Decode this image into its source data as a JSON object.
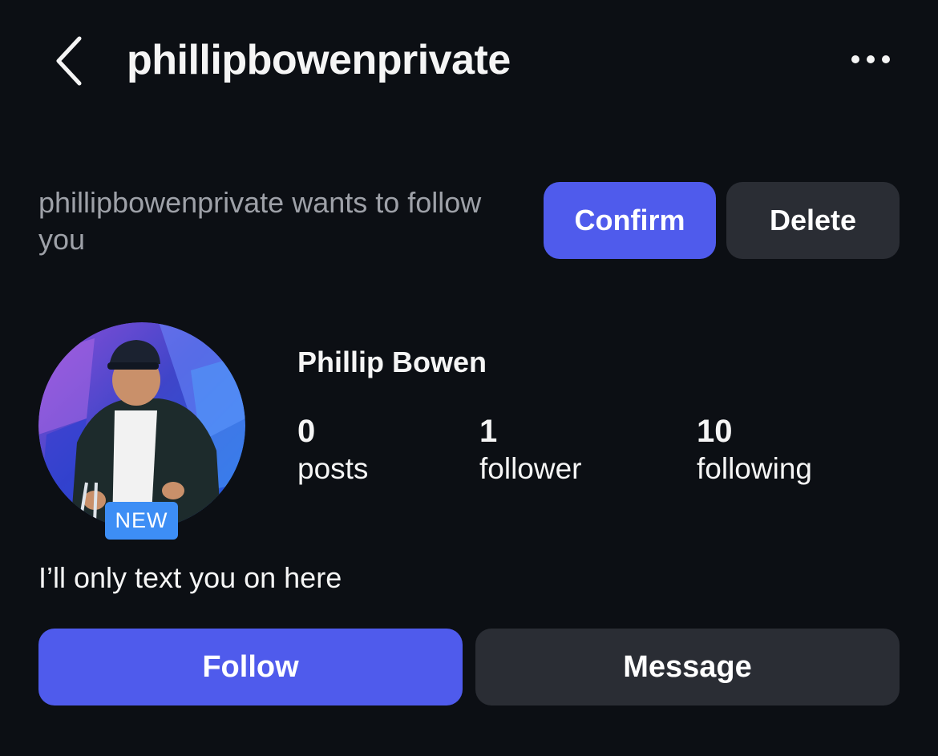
{
  "header": {
    "title": "phillipbowenprivate",
    "back_icon": "chevron-left-icon",
    "more_icon": "more-horizontal-icon"
  },
  "follow_request": {
    "text": "phillipbowenprivate wants to follow you",
    "confirm_label": "Confirm",
    "delete_label": "Delete"
  },
  "profile": {
    "display_name": "Phillip Bowen",
    "badge": "NEW",
    "stats": [
      {
        "count": "0",
        "label": "posts"
      },
      {
        "count": "1",
        "label": "follower"
      },
      {
        "count": "10",
        "label": "following"
      }
    ],
    "bio": "I’ll only text you on here"
  },
  "actions": {
    "follow_label": "Follow",
    "message_label": "Message"
  },
  "colors": {
    "background": "#0c0f14",
    "primary": "#4f5bec",
    "secondary": "#2a2d34",
    "badge": "#3d8ef5",
    "muted_text": "#9ea1a8"
  }
}
